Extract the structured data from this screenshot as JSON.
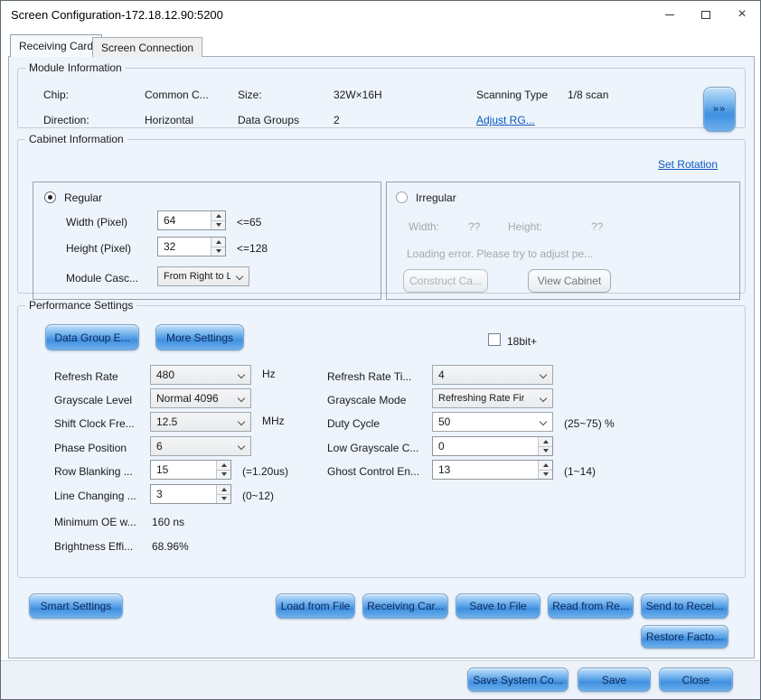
{
  "window": {
    "title": "Screen Configuration-172.18.12.90:5200"
  },
  "tabs": {
    "receiving_card": "Receiving Card",
    "screen_connection": "Screen Connection"
  },
  "module_info": {
    "title": "Module Information",
    "chip_label": "Chip:",
    "chip_value": "Common C...",
    "size_label": "Size:",
    "size_value": "32W×16H",
    "scanning_type_label": "Scanning Type",
    "scanning_type_value": "1/8 scan",
    "direction_label": "Direction:",
    "direction_value": "Horizontal",
    "data_groups_label": "Data Groups",
    "data_groups_value": "2",
    "adjust_rg_link": "Adjust RG...",
    "expand_button": "»»"
  },
  "cabinet_info": {
    "title": "Cabinet Information",
    "set_rotation_link": "Set Rotation",
    "regular": {
      "radio_label": "Regular",
      "width_label": "Width (Pixel)",
      "width_value": "64",
      "width_hint": "<=65",
      "height_label": "Height (Pixel)",
      "height_value": "32",
      "height_hint": "<=128",
      "cascade_label": "Module Casc...",
      "cascade_value": "From Right to L"
    },
    "irregular": {
      "radio_label": "Irregular",
      "width_label": "Width:",
      "width_value": "??",
      "height_label": "Height:",
      "height_value": "??",
      "error_text": "Loading error. Please try to adjust pe...",
      "construct_button": "Construct Ca...",
      "view_button": "View Cabinet"
    }
  },
  "performance": {
    "title": "Performance Settings",
    "data_group_button": "Data Group E...",
    "more_settings_button": "More Settings",
    "bit18_label": "18bit+",
    "refresh_rate_label": "Refresh Rate",
    "refresh_rate_value": "480",
    "refresh_rate_unit": "Hz",
    "refresh_rate_times_label": "Refresh Rate Ti...",
    "refresh_rate_times_value": "4",
    "grayscale_level_label": "Grayscale Level",
    "grayscale_level_value": "Normal 4096",
    "grayscale_mode_label": "Grayscale Mode",
    "grayscale_mode_value": "Refreshing Rate Fir",
    "shift_clock_label": "Shift Clock Fre...",
    "shift_clock_value": "12.5",
    "shift_clock_unit": "MHz",
    "duty_cycle_label": "Duty Cycle",
    "duty_cycle_value": "50",
    "duty_cycle_hint": "(25~75) %",
    "phase_position_label": "Phase Position",
    "phase_position_value": "6",
    "low_grayscale_label": "Low Grayscale C...",
    "low_grayscale_value": "0",
    "row_blanking_label": "Row Blanking ...",
    "row_blanking_value": "15",
    "row_blanking_hint": "(=1.20us)",
    "ghost_control_label": "Ghost Control En...",
    "ghost_control_value": "13",
    "ghost_control_hint": "(1~14)",
    "line_changing_label": "Line Changing ...",
    "line_changing_value": "3",
    "line_changing_hint": "(0~12)",
    "min_oe_label": "Minimum OE w...",
    "min_oe_value": "160 ns",
    "brightness_label": "Brightness Effi...",
    "brightness_value": "68.96%"
  },
  "actions": {
    "smart_settings": "Smart Settings",
    "load_from_file": "Load from File",
    "receiving_card": "Receiving Car...",
    "save_to_file": "Save to File",
    "read_from_receiving": "Read from Re...",
    "send_to_receiving": "Send to Recei...",
    "restore_factory": "Restore Facto...",
    "save_system_config": "Save System Co...",
    "save": "Save",
    "close": "Close"
  },
  "colors": {
    "accent_button_blue": "#4a96e3",
    "link_blue": "#0a58c0",
    "page_background": "#eef4fb"
  }
}
